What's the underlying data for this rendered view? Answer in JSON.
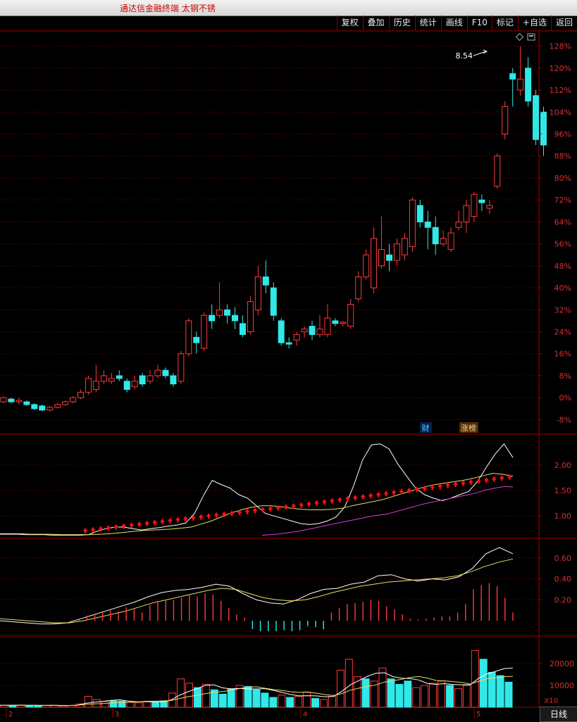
{
  "window": {
    "title": "通达信金融终端  太钢不锈"
  },
  "toolbar": {
    "buttons": [
      "复权",
      "叠加",
      "历史",
      "统计",
      "画线",
      "F10",
      "标记",
      "+自选",
      "返回"
    ]
  },
  "main_panel": {
    "price_marker": "8.54",
    "y_ticks": [
      "128%",
      "120%",
      "112%",
      "104%",
      "96%",
      "88%",
      "80%",
      "72%",
      "64%",
      "56%",
      "48%",
      "40%",
      "32%",
      "24%",
      "16%",
      "8%",
      "0%",
      "-8%"
    ],
    "badges": {
      "finance": "财",
      "limit_list": "涨榜"
    }
  },
  "panel2": {
    "y_ticks": [
      "2.00",
      "1.50",
      "1.00"
    ]
  },
  "panel3": {
    "y_ticks": [
      "0.60",
      "0.40",
      "0.20"
    ]
  },
  "volume_panel": {
    "y_ticks": [
      "20000",
      "10000"
    ],
    "unit": "X10"
  },
  "x_axis": {
    "labels": [
      "2",
      "3",
      "4",
      "5"
    ]
  },
  "footer": {
    "period_tab": "日线"
  },
  "colors": {
    "up": "#ff3a3a",
    "down": "#30e8e8",
    "grid": "#5a0000",
    "border": "#a00000",
    "text": "#d83030"
  },
  "chart_data": [
    {
      "type": "candlestick",
      "y_unit": "percent change",
      "ylim": [
        -12,
        132
      ],
      "series": [
        {
          "name": "daily",
          "values": [
            [
              -1.5,
              0,
              0.5,
              -2
            ],
            [
              -0.5,
              -1.5,
              0,
              -2
            ],
            [
              -1.5,
              -1,
              0,
              -2.5
            ],
            [
              -1.5,
              -2.5,
              -1,
              -3
            ],
            [
              -2.5,
              -4,
              -2,
              -4.5
            ],
            [
              -3,
              -4.5,
              -2.5,
              -5
            ],
            [
              -4.5,
              -3.5,
              -3,
              -5
            ],
            [
              -3.5,
              -2.5,
              -2,
              -4
            ],
            [
              -2.5,
              -1.5,
              -1,
              -3
            ],
            [
              -1.5,
              0,
              0.5,
              -2
            ],
            [
              0,
              2,
              3,
              -0.5
            ],
            [
              2,
              7,
              8,
              1
            ],
            [
              3,
              6,
              12,
              2
            ],
            [
              6,
              8,
              10,
              5
            ],
            [
              6,
              7,
              9,
              5
            ],
            [
              8,
              7,
              10,
              6
            ],
            [
              6,
              3,
              7,
              2
            ],
            [
              4,
              6,
              8,
              3
            ],
            [
              8,
              5,
              9,
              4
            ],
            [
              6,
              8,
              10,
              5
            ],
            [
              8,
              10,
              12,
              7
            ],
            [
              10,
              8,
              11,
              7
            ],
            [
              8,
              5,
              9,
              4
            ],
            [
              6,
              16,
              17,
              5
            ],
            [
              16,
              28,
              29,
              15
            ],
            [
              22,
              20,
              24,
              16
            ],
            [
              18,
              30,
              31,
              17
            ],
            [
              30,
              28,
              34,
              25
            ],
            [
              30,
              32,
              42,
              29
            ],
            [
              32,
              30,
              34,
              27
            ],
            [
              30,
              28,
              33,
              25
            ],
            [
              27,
              23,
              30,
              22
            ],
            [
              24,
              35,
              37,
              23
            ],
            [
              32,
              44,
              48,
              30
            ],
            [
              44,
              41,
              50,
              38
            ],
            [
              40,
              30,
              42,
              28
            ],
            [
              28,
              20,
              29,
              19
            ],
            [
              20,
              19.5,
              22,
              18
            ],
            [
              21,
              23,
              24,
              19
            ],
            [
              24,
              25,
              26,
              22
            ],
            [
              26,
              23,
              28,
              21
            ],
            [
              23,
              25,
              30,
              22
            ],
            [
              23,
              29,
              34,
              22
            ],
            [
              28,
              27,
              29,
              26
            ],
            [
              27,
              27.5,
              28,
              26
            ],
            [
              26,
              34,
              36,
              25
            ],
            [
              36,
              44,
              46,
              35
            ],
            [
              44,
              52,
              54,
              43
            ],
            [
              40,
              58,
              62,
              38
            ],
            [
              48,
              54,
              66,
              47
            ],
            [
              52,
              50,
              56,
              46
            ],
            [
              50,
              56,
              58,
              48
            ],
            [
              52,
              58,
              60,
              50
            ],
            [
              55,
              72,
              73,
              53
            ],
            [
              70,
              64,
              72,
              62
            ],
            [
              64,
              62,
              68,
              54
            ],
            [
              62,
              56,
              66,
              52
            ],
            [
              56,
              58,
              61,
              55
            ],
            [
              54,
              60,
              62,
              53
            ],
            [
              62,
              64,
              68,
              61
            ],
            [
              64,
              70,
              72,
              60
            ],
            [
              66,
              74,
              75,
              64
            ],
            [
              72,
              71,
              74,
              68
            ],
            [
              69,
              70,
              72,
              67
            ],
            [
              77,
              88,
              89,
              76
            ],
            [
              96,
              106,
              108,
              94
            ],
            [
              118,
              116,
              120,
              106
            ],
            [
              112,
              116,
              128,
              110
            ],
            [
              120,
              108,
              124,
              106
            ],
            [
              110,
              94,
              112,
              92
            ],
            [
              104,
              92,
              106,
              88
            ]
          ]
        }
      ]
    },
    {
      "type": "line",
      "y_unit": "ratio",
      "ylim": [
        0.6,
        2.5
      ],
      "series": [
        {
          "name": "white",
          "values": [
            0.64,
            0.64,
            0.64,
            0.63,
            0.63,
            0.63,
            0.62,
            0.62,
            0.62,
            0.62,
            0.63,
            0.7,
            0.75,
            0.78,
            0.78,
            0.75,
            0.72,
            0.75,
            0.77,
            0.8,
            0.82,
            0.86,
            1.05,
            1.4,
            1.7,
            1.62,
            1.55,
            1.42,
            1.35,
            1.2,
            1.05,
            1,
            0.95,
            0.9,
            0.85,
            0.83,
            0.85,
            0.9,
            0.98,
            1.18,
            1.6,
            2.1,
            2.4,
            2.42,
            2.32,
            2.02,
            1.78,
            1.55,
            1.42,
            1.35,
            1.3,
            1.35,
            1.42,
            1.48,
            1.68,
            1.96,
            2.22,
            2.42,
            2.15
          ]
        },
        {
          "name": "yellow",
          "values": [
            0.65,
            0.65,
            0.65,
            0.64,
            0.64,
            0.64,
            0.63,
            0.63,
            0.63,
            0.63,
            0.64,
            0.65,
            0.67,
            0.69,
            0.71,
            0.72,
            0.73,
            0.74,
            0.76,
            0.78,
            0.84,
            0.9,
            0.98,
            1.06,
            1.12,
            1.17,
            1.2,
            1.2,
            1.18,
            1.15,
            1.13,
            1.12,
            1.12,
            1.13,
            1.15,
            1.2,
            1.24,
            1.28,
            1.32,
            1.38,
            1.44,
            1.5,
            1.56,
            1.61,
            1.64,
            1.67,
            1.7,
            1.74,
            1.79,
            1.84,
            1.82,
            1.78
          ]
        },
        {
          "name": "magenta",
          "values": [
            0.62,
            0.63,
            0.64,
            0.66,
            0.68,
            0.7,
            0.73,
            0.76,
            0.79,
            0.82,
            0.85,
            0.88,
            0.91,
            0.94,
            0.97,
            1,
            1.02,
            1.04,
            1.08,
            1.12,
            1.16,
            1.2,
            1.24,
            1.27,
            1.3,
            1.33,
            1.36,
            1.39,
            1.42,
            1.45,
            1.5,
            1.53,
            1.56,
            1.58,
            1.57
          ]
        }
      ]
    },
    {
      "type": "line",
      "y_unit": "value",
      "ylim": [
        -0.12,
        0.72
      ],
      "series": [
        {
          "name": "white",
          "values": [
            0,
            -0.01,
            -0.02,
            -0.03,
            -0.03,
            -0.02,
            0.02,
            0.06,
            0.1,
            0.14,
            0.18,
            0.23,
            0.27,
            0.29,
            0.3,
            0.32,
            0.35,
            0.33,
            0.26,
            0.2,
            0.17,
            0.16,
            0.2,
            0.26,
            0.3,
            0.31,
            0.35,
            0.37,
            0.43,
            0.44,
            0.4,
            0.38,
            0.4,
            0.39,
            0.42,
            0.5,
            0.64,
            0.7,
            0.64
          ]
        },
        {
          "name": "yellow",
          "values": [
            0.02,
            0.01,
            0,
            -0.01,
            -0.02,
            -0.02,
            0,
            0.03,
            0.06,
            0.09,
            0.13,
            0.17,
            0.2,
            0.23,
            0.26,
            0.29,
            0.31,
            0.3,
            0.26,
            0.22,
            0.2,
            0.19,
            0.2,
            0.23,
            0.27,
            0.3,
            0.33,
            0.35,
            0.37,
            0.38,
            0.39,
            0.4,
            0.41,
            0.43,
            0.47,
            0.52,
            0.56,
            0.59
          ]
        },
        {
          "name": "macd",
          "values": [
            0,
            0,
            0,
            0,
            0,
            0,
            0,
            0,
            0,
            0,
            0.01,
            0.05,
            0.06,
            0.08,
            0.1,
            0.09,
            0.13,
            0.11,
            0.08,
            0.15,
            0.18,
            0.2,
            0.2,
            0.22,
            0.25,
            0.23,
            0.26,
            0.25,
            0.19,
            0.12,
            0.06,
            0.03,
            -0.08,
            -0.1,
            -0.1,
            -0.1,
            -0.09,
            -0.1,
            -0.09,
            -0.05,
            -0.06,
            -0.08,
            0.08,
            0.12,
            0.16,
            0.17,
            0.18,
            0.2,
            0.19,
            0.14,
            0.11,
            0.06,
            0.02,
            0.01,
            0.02,
            0.03,
            0.04,
            0.04,
            0.08,
            0.16,
            0.3,
            0.34,
            0.36,
            0.33,
            0.22,
            0.08
          ]
        }
      ]
    },
    {
      "type": "bar",
      "y_unit": "X10",
      "ylim": [
        0,
        30000
      ],
      "series": [
        {
          "name": "volume",
          "values": [
            900,
            900,
            1000,
            800,
            700,
            800,
            900,
            600,
            800,
            1500,
            5000,
            3500,
            2600,
            3000,
            2800,
            2200,
            2000,
            2800,
            2400,
            2800,
            6500,
            13000,
            11000,
            9000,
            10500,
            8000,
            6000,
            8500,
            10000,
            9500,
            8000,
            6500,
            4500,
            5500,
            4500,
            5000,
            7000,
            4000,
            3500,
            5000,
            17000,
            22000,
            14000,
            13000,
            12000,
            18000,
            13000,
            10500,
            12000,
            9000,
            10000,
            11000,
            12000,
            10000,
            8500,
            10000,
            26000,
            22000,
            16000,
            14500,
            11500
          ]
        }
      ]
    }
  ]
}
